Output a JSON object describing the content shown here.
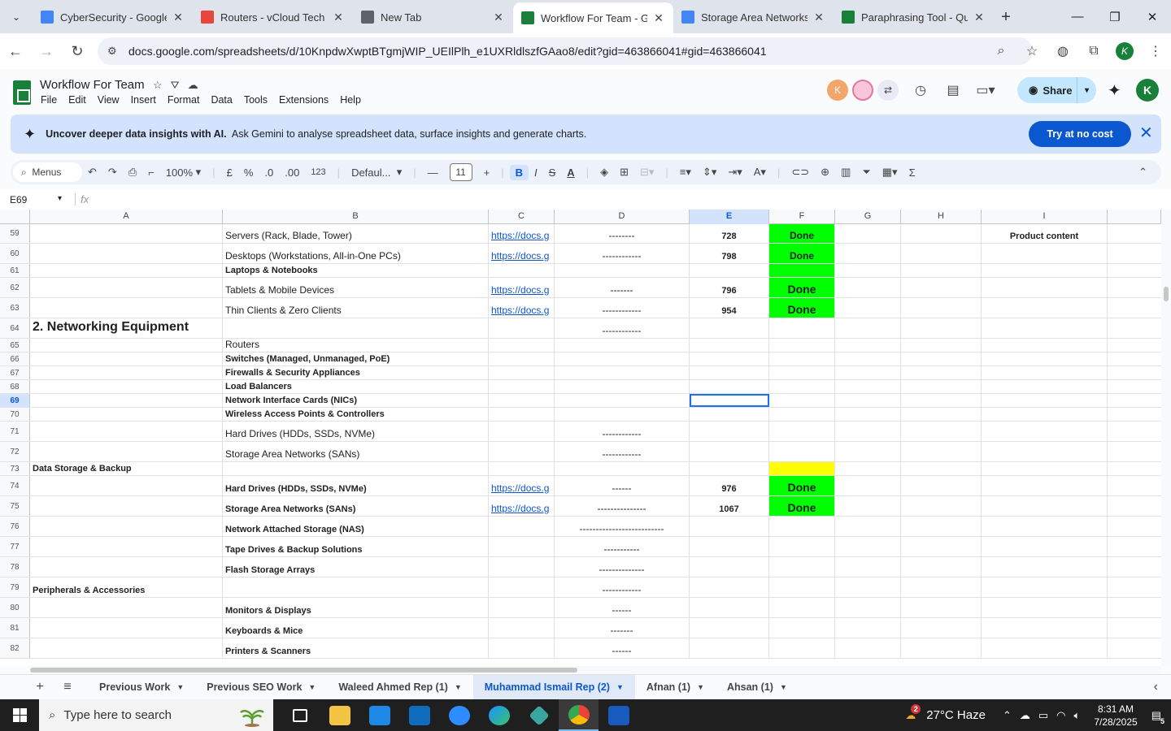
{
  "browser": {
    "tabs": [
      {
        "title": "CyberSecurity - Google",
        "color": "#4285f4"
      },
      {
        "title": "Routers - vCloud Tech",
        "color": "#e8453c"
      },
      {
        "title": "New Tab",
        "color": "#5f6368"
      },
      {
        "title": "Workflow For Team - Go",
        "color": "#188038"
      },
      {
        "title": "Storage Area Networks",
        "color": "#4285f4"
      },
      {
        "title": "Paraphrasing Tool - Qui",
        "color": "#188038"
      }
    ],
    "active_tab": 3,
    "url": "docs.google.com/spreadsheets/d/10KnpdwXwptBTgmjWIP_UEIlPlh_e1UXRldlszfGAao8/edit?gid=463866041#gid=463866041",
    "profile_initial": "K"
  },
  "app": {
    "title": "Workflow For Team",
    "menus": [
      "File",
      "Edit",
      "View",
      "Insert",
      "Format",
      "Data",
      "Tools",
      "Extensions",
      "Help"
    ],
    "share_label": "Share",
    "user_initial": "K",
    "collab_initial": "K"
  },
  "banner": {
    "bold_text": "Uncover deeper data insights with AI.",
    "text": "Ask Gemini to analyse spreadsheet data, surface insights and generate charts.",
    "button": "Try at no cost"
  },
  "toolbar": {
    "menus_label": "Menus",
    "zoom": "100%",
    "currency": "£",
    "percent": "%",
    "dec_dec": ".0",
    "inc_dec": ".00",
    "num_format": "123",
    "font": "Defaul...",
    "font_size": "11",
    "bold": "B",
    "italic": "I",
    "strike": "S",
    "text_color": "A"
  },
  "formula": {
    "cell_ref": "E69",
    "fx": "fx",
    "value": ""
  },
  "columns": [
    "A",
    "B",
    "C",
    "D",
    "E",
    "F",
    "G",
    "H",
    "I"
  ],
  "selected_column": "E",
  "selected_row": "69",
  "rows": [
    {
      "n": "59",
      "A": "",
      "B": "Servers (Rack, Blade, Tower)",
      "C": "https://docs.g",
      "D": "--------",
      "E": "728",
      "F": "Done",
      "I": "Product content"
    },
    {
      "n": "60",
      "A": "",
      "B": "Desktops (Workstations, All-in-One PCs)",
      "C": "https://docs.g",
      "D": "------------",
      "E": "798",
      "F": "Done"
    },
    {
      "n": "61",
      "A": "",
      "B": "Laptops & Notebooks",
      "C": "",
      "D": "",
      "E": "",
      "F": ""
    },
    {
      "n": "62",
      "A": "",
      "B": "Tablets & Mobile Devices",
      "C": "https://docs.g",
      "D": "-------",
      "E": "796",
      "F": "Done"
    },
    {
      "n": "63",
      "A": "",
      "B": "Thin Clients & Zero Clients",
      "C": "https://docs.g",
      "D": "------------",
      "E": "954",
      "F": "Done"
    },
    {
      "n": "64",
      "A": "2. Networking Equipment",
      "B": "",
      "C": "",
      "D": "------------",
      "E": "",
      "F": ""
    },
    {
      "n": "65",
      "A": "",
      "B": "Routers",
      "C": "",
      "D": "",
      "E": "",
      "F": ""
    },
    {
      "n": "66",
      "A": "",
      "B": "Switches (Managed, Unmanaged, PoE)",
      "C": "",
      "D": "",
      "E": "",
      "F": ""
    },
    {
      "n": "67",
      "A": "",
      "B": "Firewalls & Security Appliances",
      "C": "",
      "D": "",
      "E": "",
      "F": ""
    },
    {
      "n": "68",
      "A": "",
      "B": "Load Balancers",
      "C": "",
      "D": "",
      "E": "",
      "F": ""
    },
    {
      "n": "69",
      "A": "",
      "B": "Network Interface Cards (NICs)",
      "C": "",
      "D": "",
      "E": "",
      "F": ""
    },
    {
      "n": "70",
      "A": "",
      "B": "Wireless Access Points & Controllers",
      "C": "",
      "D": "",
      "E": "",
      "F": ""
    },
    {
      "n": "71",
      "A": "",
      "B": "Hard Drives (HDDs, SSDs, NVMe)",
      "C": "",
      "D": "------------",
      "E": "",
      "F": ""
    },
    {
      "n": "72",
      "A": "",
      "B": "Storage Area Networks (SANs)",
      "C": "",
      "D": "------------",
      "E": "",
      "F": ""
    },
    {
      "n": "73",
      "A": "Data Storage & Backup",
      "B": "",
      "C": "",
      "D": "",
      "E": "",
      "F": ""
    },
    {
      "n": "74",
      "A": "",
      "B": "Hard Drives (HDDs, SSDs, NVMe)",
      "C": "https://docs.g",
      "D": "------",
      "E": "976",
      "F": "Done"
    },
    {
      "n": "75",
      "A": "",
      "B": "Storage Area Networks (SANs)",
      "C": "https://docs.g",
      "D": "---------------",
      "E": "1067",
      "F": "Done"
    },
    {
      "n": "76",
      "A": "",
      "B": "Network Attached Storage (NAS)",
      "C": "",
      "D": "--------------------------",
      "E": "",
      "F": ""
    },
    {
      "n": "77",
      "A": "",
      "B": "Tape Drives & Backup Solutions",
      "C": "",
      "D": "-----------",
      "E": "",
      "F": ""
    },
    {
      "n": "78",
      "A": "",
      "B": "Flash Storage Arrays",
      "C": "",
      "D": "--------------",
      "E": "",
      "F": ""
    },
    {
      "n": "79",
      "A": "Peripherals & Accessories",
      "B": "",
      "C": "",
      "D": "------------",
      "E": "",
      "F": ""
    },
    {
      "n": "80",
      "A": "",
      "B": "Monitors & Displays",
      "C": "",
      "D": "------",
      "E": "",
      "F": ""
    },
    {
      "n": "81",
      "A": "",
      "B": "Keyboards & Mice",
      "C": "",
      "D": "-------",
      "E": "",
      "F": ""
    },
    {
      "n": "82",
      "A": "",
      "B": "Printers & Scanners",
      "C": "",
      "D": "------",
      "E": "",
      "F": ""
    }
  ],
  "sheet_tabs": [
    "Previous Work",
    "Previous SEO Work",
    "Waleed Ahmed Rep (1)",
    "Muhammad Ismail Rep (2)",
    "Afnan (1)",
    "Ahsan (1)"
  ],
  "active_sheet": 3,
  "taskbar": {
    "search_placeholder": "Type here to search",
    "weather": "27°C  Haze",
    "weather_badge": "2",
    "time": "8:31 AM",
    "date": "7/28/2025",
    "notif_count": "5"
  }
}
